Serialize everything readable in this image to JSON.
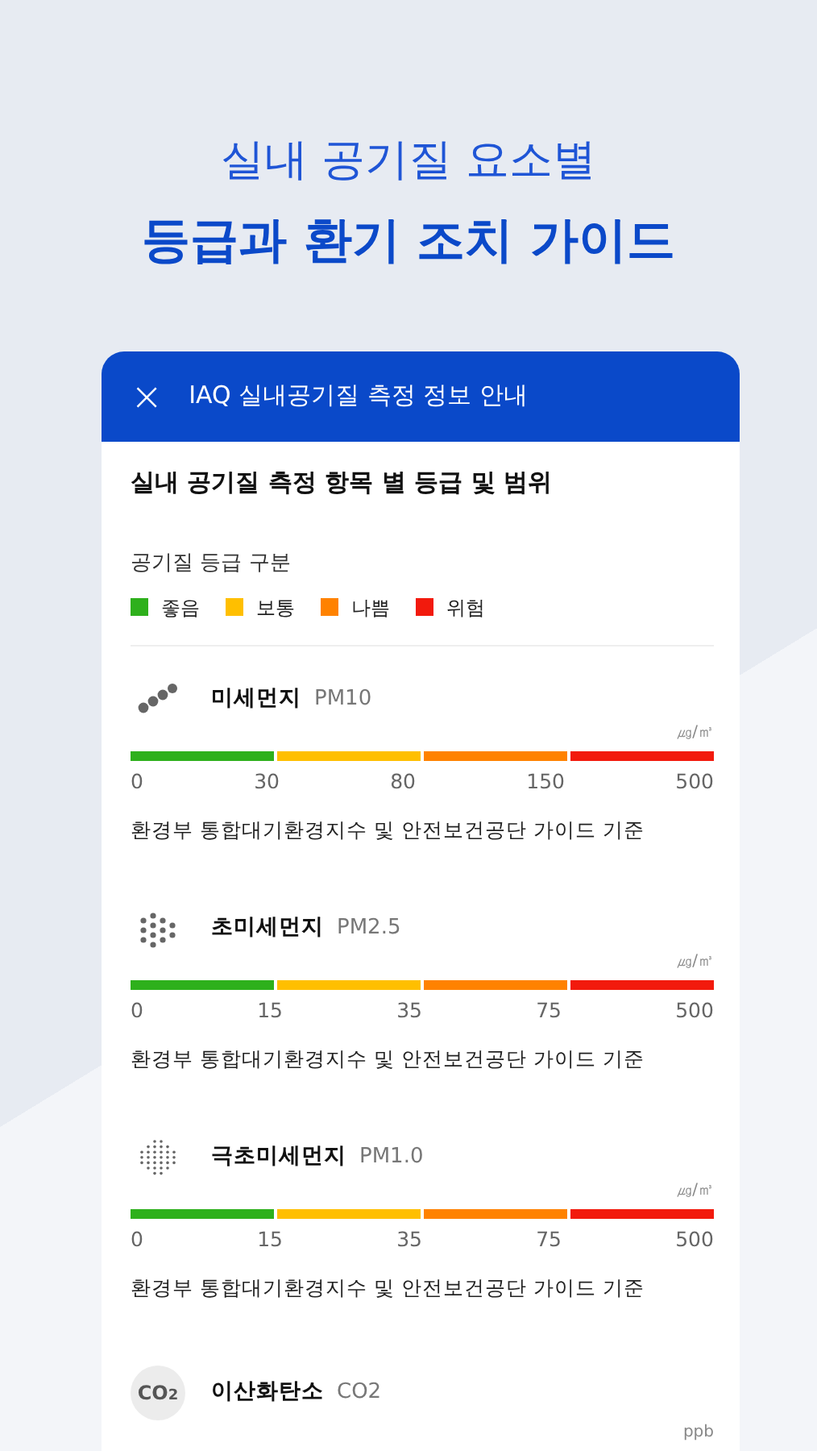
{
  "headline": {
    "line_1": "실내 공기질 요소별",
    "line_2": "등급과 환기 조치 가이드"
  },
  "dialog": {
    "close": "×",
    "title": "IAQ 실내공기질 측정 정보 안내",
    "heading": "실내 공기질 측정 항목 별 등급 및 범위",
    "legend_title": "공기질 등급 구분",
    "legend": [
      {
        "label": "좋음",
        "color": "#2eb01c"
      },
      {
        "label": "보통",
        "color": "#ffbf00"
      },
      {
        "label": "나쁨",
        "color": "#ff8200"
      },
      {
        "label": "위험",
        "color": "#f21a0d"
      }
    ],
    "items": [
      {
        "kind": "coarse",
        "name": "미세먼지",
        "code": "PM10",
        "unit": "㎍/㎥",
        "ticks": [
          "0",
          "30",
          "80",
          "150",
          "500"
        ],
        "note": "환경부 통합대기환경지수 및 안전보건공단 가이드 기준"
      },
      {
        "kind": "fine",
        "name": "초미세먼지",
        "code": "PM2.5",
        "unit": "㎍/㎥",
        "ticks": [
          "0",
          "15",
          "35",
          "75",
          "500"
        ],
        "note": "환경부 통합대기환경지수 및 안전보건공단 가이드 기준"
      },
      {
        "kind": "ultrafine",
        "name": "극초미세먼지",
        "code": "PM1.0",
        "unit": "㎍/㎥",
        "ticks": [
          "0",
          "15",
          "35",
          "75",
          "500"
        ],
        "note": "환경부 통합대기환경지수 및 안전보건공단 가이드 기준"
      },
      {
        "kind": "co2",
        "icon_text": "CO$_{2}$",
        "name": "이산화탄소",
        "code": "CO2",
        "unit": "ppb"
      }
    ]
  }
}
